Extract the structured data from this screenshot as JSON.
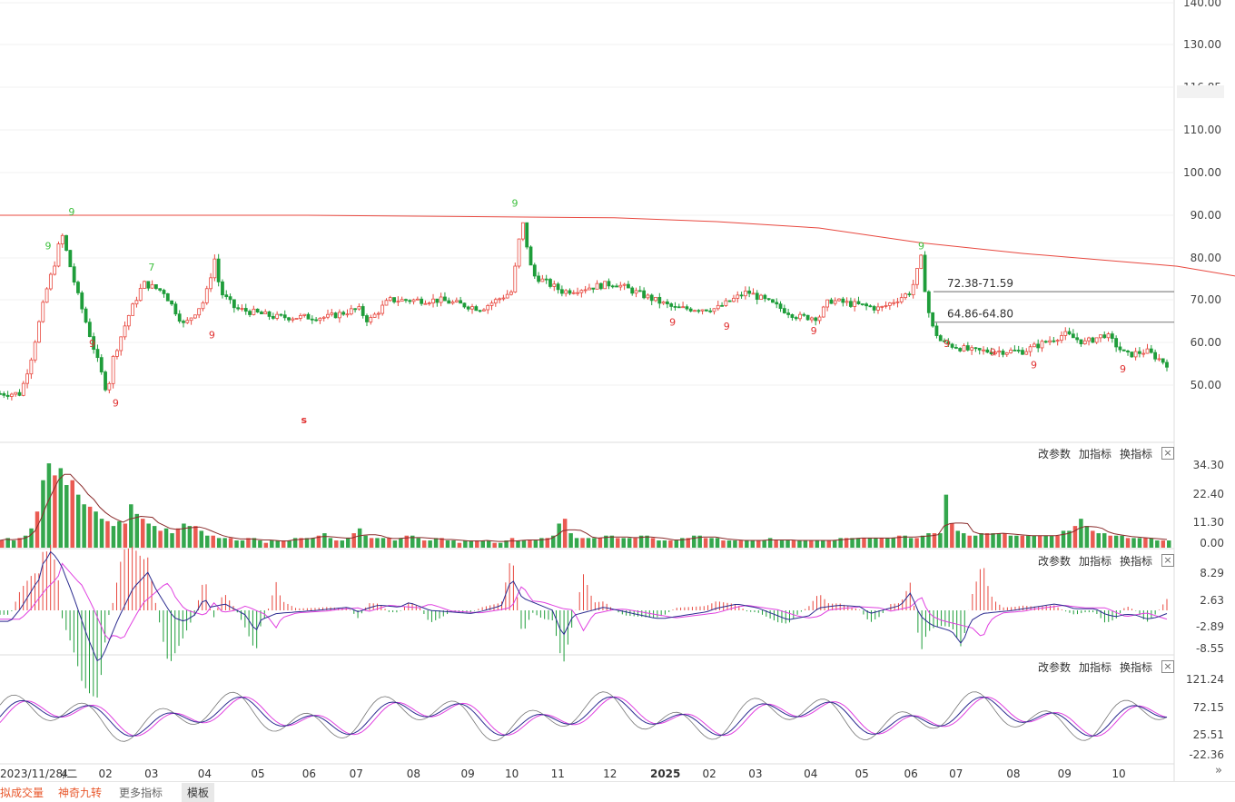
{
  "chart_data": {
    "type": "candlestick",
    "main": {
      "y_ticks": [
        "140.00",
        "130.00",
        "116.85",
        "110.00",
        "100.00",
        "90.00",
        "80.00",
        "70.00",
        "60.00",
        "50.00"
      ],
      "current_price_label": "116.85",
      "price_levels": [
        {
          "label": "72.38-71.59",
          "value": 72.0
        },
        {
          "label": "64.86-64.80",
          "value": 64.83
        }
      ],
      "ma_line": {
        "color": "#e8483f",
        "points": [
          [
            0,
            90.0
          ],
          [
            0.3,
            90.0
          ],
          [
            0.6,
            89.4
          ],
          [
            0.7,
            88.5
          ],
          [
            0.8,
            87.0
          ],
          [
            0.9,
            83.5
          ],
          [
            1.0,
            81.0
          ],
          [
            1.15,
            78.0
          ],
          [
            1.26,
            73.5
          ]
        ]
      },
      "price_path": [
        [
          0.0,
          48
        ],
        [
          0.02,
          48
        ],
        [
          0.03,
          56
        ],
        [
          0.045,
          72
        ],
        [
          0.055,
          80
        ],
        [
          0.06,
          86
        ],
        [
          0.075,
          72
        ],
        [
          0.09,
          60
        ],
        [
          0.1,
          52
        ],
        [
          0.105,
          48
        ],
        [
          0.11,
          56
        ],
        [
          0.125,
          66
        ],
        [
          0.14,
          74
        ],
        [
          0.16,
          72
        ],
        [
          0.18,
          64
        ],
        [
          0.2,
          70
        ],
        [
          0.21,
          80
        ],
        [
          0.215,
          72
        ],
        [
          0.23,
          68
        ],
        [
          0.27,
          66
        ],
        [
          0.32,
          66
        ],
        [
          0.35,
          68
        ],
        [
          0.36,
          65
        ],
        [
          0.38,
          70
        ],
        [
          0.43,
          70
        ],
        [
          0.47,
          68
        ],
        [
          0.5,
          72
        ],
        [
          0.51,
          89
        ],
        [
          0.52,
          76
        ],
        [
          0.55,
          72
        ],
        [
          0.6,
          74
        ],
        [
          0.62,
          72
        ],
        [
          0.64,
          70
        ],
        [
          0.66,
          68
        ],
        [
          0.7,
          68
        ],
        [
          0.73,
          72
        ],
        [
          0.78,
          66
        ],
        [
          0.8,
          66
        ],
        [
          0.81,
          70
        ],
        [
          0.86,
          68
        ],
        [
          0.89,
          72
        ],
        [
          0.9,
          80
        ],
        [
          0.905,
          70
        ],
        [
          0.91,
          64
        ],
        [
          0.92,
          60
        ],
        [
          0.95,
          58
        ],
        [
          1.0,
          58
        ],
        [
          1.04,
          62
        ],
        [
          1.06,
          60
        ],
        [
          1.08,
          62
        ],
        [
          1.1,
          57
        ],
        [
          1.12,
          58
        ],
        [
          1.14,
          55
        ]
      ],
      "td_marks": [
        {
          "t": "9",
          "color": "#40c040",
          "x": 0.047,
          "v": 82
        },
        {
          "t": "9",
          "color": "#40c040",
          "x": 0.07,
          "v": 90
        },
        {
          "t": "9",
          "color": "#e03030",
          "x": 0.09,
          "v": 59
        },
        {
          "t": "9",
          "color": "#e03030",
          "x": 0.113,
          "v": 45
        },
        {
          "t": "7",
          "color": "#40c040",
          "x": 0.148,
          "v": 77
        },
        {
          "t": "9",
          "color": "#e03030",
          "x": 0.207,
          "v": 61
        },
        {
          "t": "9",
          "color": "#40c040",
          "x": 0.503,
          "v": 92
        },
        {
          "t": "9",
          "color": "#e03030",
          "x": 0.657,
          "v": 64
        },
        {
          "t": "9",
          "color": "#e03030",
          "x": 0.71,
          "v": 63
        },
        {
          "t": "9",
          "color": "#e03030",
          "x": 0.795,
          "v": 62
        },
        {
          "t": "9",
          "color": "#40c040",
          "x": 0.9,
          "v": 82
        },
        {
          "t": "9",
          "color": "#e03030",
          "x": 0.925,
          "v": 59
        },
        {
          "t": "9",
          "color": "#e03030",
          "x": 0.97,
          "v": 57
        },
        {
          "t": "9",
          "color": "#e03030",
          "x": 1.01,
          "v": 54
        },
        {
          "t": "9",
          "color": "#e03030",
          "x": 1.097,
          "v": 53
        }
      ],
      "s_marker": {
        "t": "s",
        "color": "#e03030",
        "x": 0.297,
        "v": 41
      }
    },
    "volume": {
      "y_ticks": [
        "34.30",
        "22.40",
        "11.30",
        "0.00"
      ],
      "bars": [
        3,
        4,
        3,
        4,
        5,
        8,
        15,
        28,
        35,
        30,
        33,
        26,
        28,
        22,
        18,
        17,
        15,
        12,
        11,
        9,
        11,
        10,
        18,
        14,
        12,
        10,
        9,
        7,
        8,
        6,
        8,
        10,
        9,
        9,
        7,
        5,
        5,
        4,
        4,
        4,
        3,
        3,
        4,
        4,
        3,
        2,
        3,
        3,
        3,
        3,
        4,
        4,
        4,
        4,
        5,
        6,
        4,
        3,
        3,
        4,
        6,
        8,
        5,
        4,
        4,
        4,
        4,
        3,
        4,
        5,
        5,
        4,
        3,
        3,
        4,
        4,
        3,
        3,
        2,
        3,
        3,
        3,
        3,
        3,
        2,
        2,
        3,
        4,
        3,
        3,
        3,
        3,
        4,
        4,
        5,
        10,
        12,
        6,
        4,
        4,
        4,
        4,
        4,
        5,
        5,
        4,
        4,
        4,
        4,
        5,
        5,
        4,
        3,
        3,
        3,
        3,
        4,
        4,
        5,
        5,
        4,
        4,
        4,
        3,
        3,
        3,
        3,
        3,
        3,
        3,
        3,
        4,
        3,
        3,
        3,
        3,
        3,
        3,
        3,
        3,
        3,
        3,
        3,
        4,
        4,
        4,
        4,
        4,
        4,
        4,
        4,
        4,
        4,
        5,
        5,
        4,
        4,
        5,
        6,
        6,
        6,
        22,
        10,
        7,
        6,
        5,
        5,
        6,
        6,
        6,
        6,
        6,
        5,
        5,
        5,
        5,
        5,
        5,
        5,
        5,
        5,
        7,
        7,
        9,
        12,
        9,
        7,
        6,
        6,
        5,
        5,
        5,
        4,
        4,
        4,
        4,
        4,
        3,
        3,
        3
      ]
    },
    "macd": {
      "y_ticks": [
        "8.29",
        "2.63",
        "-2.89",
        "-8.55"
      ],
      "zero": 0
    },
    "kdj": {
      "y_ticks": [
        "121.24",
        "72.15",
        "25.51",
        "-22.36"
      ]
    },
    "x_ticks": [
      {
        "label": "2023/11/28/二",
        "x": 0.0
      },
      {
        "label": "4",
        "x": 0.063
      },
      {
        "label": "02",
        "x": 0.103
      },
      {
        "label": "03",
        "x": 0.148
      },
      {
        "label": "04",
        "x": 0.2
      },
      {
        "label": "05",
        "x": 0.252
      },
      {
        "label": "06",
        "x": 0.302
      },
      {
        "label": "07",
        "x": 0.348
      },
      {
        "label": "08",
        "x": 0.404
      },
      {
        "label": "09",
        "x": 0.457
      },
      {
        "label": "10",
        "x": 0.5
      },
      {
        "label": "11",
        "x": 0.545
      },
      {
        "label": "12",
        "x": 0.596
      },
      {
        "label": "2025",
        "x": 0.65
      },
      {
        "label": "02",
        "x": 0.693
      },
      {
        "label": "03",
        "x": 0.738
      },
      {
        "label": "04",
        "x": 0.792
      },
      {
        "label": "05",
        "x": 0.842
      },
      {
        "label": "06",
        "x": 0.89
      },
      {
        "label": "07",
        "x": 0.934
      },
      {
        "label": "08",
        "x": 0.99
      },
      {
        "label": "09",
        "x": 1.04
      },
      {
        "label": "10",
        "x": 1.093
      }
    ]
  },
  "panel_tools": {
    "change_params": "改参数",
    "add_indicator": "加指标",
    "switch_indicator": "换指标",
    "close": "×"
  },
  "bottom_tabs": [
    "拟成交量",
    "神奇九转",
    "更多指标",
    "模板"
  ],
  "expand_icon": "»",
  "colors": {
    "up": "#e8483f",
    "down": "#1e9d3a",
    "ma": "#e8483f",
    "dif": "#2b2b8f",
    "dea": "#e040e0",
    "k": "#777777"
  }
}
